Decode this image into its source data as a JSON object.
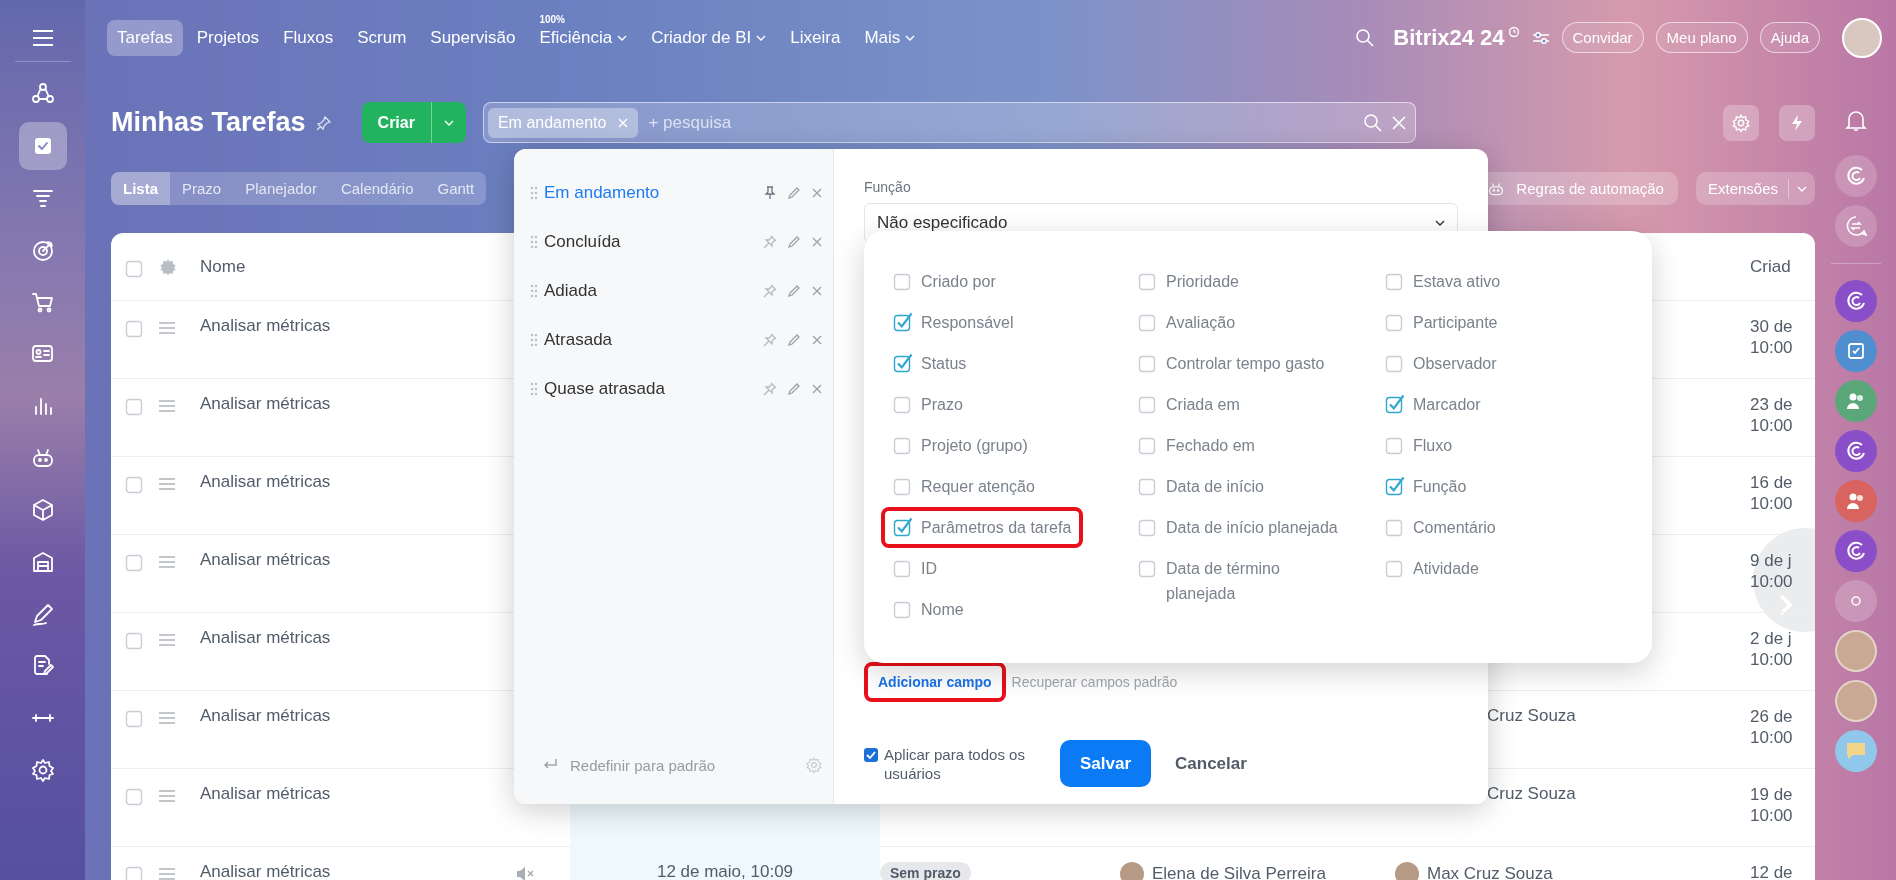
{
  "sidebar": {
    "items": [
      {
        "selected": false
      },
      {
        "selected": true
      },
      {
        "selected": false
      },
      {
        "selected": false
      },
      {
        "selected": false
      },
      {
        "selected": false
      },
      {
        "selected": false
      },
      {
        "selected": false
      },
      {
        "selected": false
      },
      {
        "selected": false
      },
      {
        "selected": false
      },
      {
        "selected": false
      },
      {
        "selected": false
      },
      {
        "selected": false
      }
    ]
  },
  "top_nav": {
    "items": [
      {
        "label": "Tarefas",
        "selected": true,
        "dropdown": false
      },
      {
        "label": "Projetos",
        "selected": false,
        "dropdown": false
      },
      {
        "label": "Fluxos",
        "selected": false,
        "dropdown": false
      },
      {
        "label": "Scrum",
        "selected": false,
        "dropdown": false
      },
      {
        "label": "Supervisão",
        "selected": false,
        "dropdown": false
      },
      {
        "label": "Eficiência",
        "badge": "100%",
        "selected": false,
        "dropdown": true
      },
      {
        "label": "Criador de BI",
        "selected": false,
        "dropdown": true
      },
      {
        "label": "Lixeira",
        "selected": false,
        "dropdown": false
      },
      {
        "label": "Mais",
        "selected": false,
        "dropdown": true
      }
    ],
    "logo": "Bitrix24",
    "logo_suffix": "24",
    "buttons": [
      "Convidar",
      "Meu plano",
      "Ajuda"
    ]
  },
  "header": {
    "title": "Minhas Tarefas",
    "create_button": "Criar",
    "search": {
      "chips": [
        "Em andamento"
      ],
      "placeholder": "+ pesquisa"
    }
  },
  "view_tabs": [
    {
      "label": "Lista",
      "selected": true
    },
    {
      "label": "Prazo",
      "selected": false
    },
    {
      "label": "Planejador",
      "selected": false
    },
    {
      "label": "Calendário",
      "selected": false
    },
    {
      "label": "Gantt",
      "selected": false
    }
  ],
  "automation_button": "Regras de automação",
  "extensions_button": "Extensões",
  "table": {
    "select_all_checked": false,
    "name_column": "Nome",
    "last_column": "Criad",
    "rows": [
      {
        "checked": false,
        "name": "Analisar métricas",
        "muted": false,
        "created": [
          "30 de",
          "10:00"
        ]
      },
      {
        "checked": false,
        "name": "Analisar métricas",
        "muted": false,
        "created": [
          "23 de",
          "10:00"
        ]
      },
      {
        "checked": false,
        "name": "Analisar métricas",
        "muted": false,
        "created": [
          "16 de",
          "10:00"
        ]
      },
      {
        "checked": false,
        "name": "Analisar métricas",
        "muted": false,
        "created": [
          "9 de j",
          "10:00"
        ]
      },
      {
        "checked": false,
        "name": "Analisar métricas",
        "muted": false,
        "created": [
          "2 de j",
          "10:00"
        ]
      },
      {
        "checked": false,
        "name": "Analisar métricas",
        "muted": false,
        "creator": "Cruz Souza",
        "created": [
          "26 de",
          "10:00"
        ]
      },
      {
        "checked": false,
        "name": "Analisar métricas",
        "muted": false,
        "creator": "Cruz Souza",
        "created": [
          "19 de",
          "10:00"
        ]
      },
      {
        "checked": false,
        "name": "Analisar métricas",
        "muted": true,
        "date": "12 de maio, 10:09",
        "deadline": "Sem prazo",
        "responsible": "Elena de Silva Perreira",
        "creator": "Max Cruz Souza",
        "created": [
          "12 de"
        ]
      }
    ]
  },
  "filter_popup": {
    "presets": [
      {
        "label": "Em andamento",
        "selected": true,
        "pinned": true
      },
      {
        "label": "Concluída",
        "selected": false,
        "pinned": false
      },
      {
        "label": "Adiada",
        "selected": false,
        "pinned": false
      },
      {
        "label": "Atrasada",
        "selected": false,
        "pinned": false
      },
      {
        "label": "Quase atrasada",
        "selected": false,
        "pinned": false
      }
    ],
    "reset_link": "Redefinir para padrão",
    "field": {
      "label": "Função",
      "value": "Não especificado"
    },
    "field_chooser": {
      "columns": [
        {
          "fields": [
            {
              "label": "Criado por",
              "checked": false,
              "highlighted": false
            },
            {
              "label": "Responsável",
              "checked": true,
              "highlighted": false
            },
            {
              "label": "Status",
              "checked": true,
              "highlighted": false
            },
            {
              "label": "Prazo",
              "checked": false,
              "highlighted": false
            },
            {
              "label": "Projeto (grupo)",
              "checked": false,
              "highlighted": false
            },
            {
              "label": "Requer atenção",
              "checked": false,
              "highlighted": false
            },
            {
              "label": "Parâmetros da tarefa",
              "checked": true,
              "highlighted": true
            },
            {
              "label": "ID",
              "checked": false,
              "highlighted": false
            },
            {
              "label": "Nome",
              "checked": false,
              "highlighted": false
            }
          ]
        },
        {
          "fields": [
            {
              "label": "Prioridade",
              "checked": false,
              "highlighted": false
            },
            {
              "label": "Avaliação",
              "checked": false,
              "highlighted": false
            },
            {
              "label": "Controlar tempo gasto",
              "checked": false,
              "highlighted": false
            },
            {
              "label": "Criada em",
              "checked": false,
              "highlighted": false
            },
            {
              "label": "Fechado em",
              "checked": false,
              "highlighted": false
            },
            {
              "label": "Data de início",
              "checked": false,
              "highlighted": false
            },
            {
              "label": "Data de início planejada",
              "checked": false,
              "highlighted": false
            },
            {
              "label": "Data de término planejada",
              "checked": false,
              "highlighted": false
            }
          ]
        },
        {
          "fields": [
            {
              "label": "Estava ativo",
              "checked": false,
              "highlighted": false
            },
            {
              "label": "Participante",
              "checked": false,
              "highlighted": false
            },
            {
              "label": "Observador",
              "checked": false,
              "highlighted": false
            },
            {
              "label": "Marcador",
              "checked": true,
              "highlighted": false
            },
            {
              "label": "Fluxo",
              "checked": false,
              "highlighted": false
            },
            {
              "label": "Função",
              "checked": true,
              "highlighted": false
            },
            {
              "label": "Comentário",
              "checked": false,
              "highlighted": false
            },
            {
              "label": "Atividade",
              "checked": false,
              "highlighted": false
            }
          ]
        }
      ]
    },
    "add_field": {
      "label": "Adicionar campo",
      "highlighted": true
    },
    "restore_link": "Recuperar campos padrão",
    "apply_all": {
      "label": "Aplicar para todos os usuários",
      "checked": true
    },
    "save_button": "Salvar",
    "cancel_button": "Cancelar"
  }
}
